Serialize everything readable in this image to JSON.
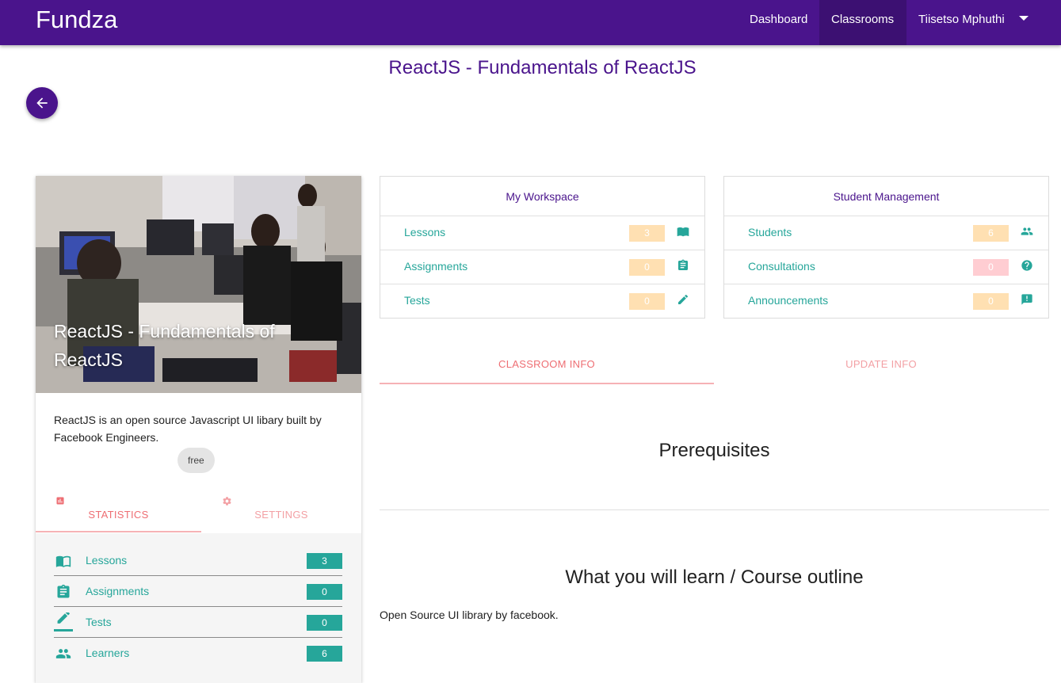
{
  "navbar": {
    "brand": "Fundza",
    "items": [
      {
        "label": "Dashboard",
        "active": false
      },
      {
        "label": "Classrooms",
        "active": true
      },
      {
        "label": "Tiisetso Mphuthi",
        "active": false
      }
    ],
    "color": "#4a148c"
  },
  "page": {
    "title": "ReactJS - Fundamentals of ReactJS",
    "back_icon": "arrow-back-icon"
  },
  "course_card": {
    "title": "ReactJS - Fundamentals of ReactJS",
    "description": "ReactJS is an open source Javascript UI libary built by Facebook Engineers.",
    "price_chip": "free",
    "tabs": [
      {
        "label": "STATISTICS",
        "icon": "bar-chart-icon",
        "active": true
      },
      {
        "label": "SETTINGS",
        "icon": "gear-icon",
        "active": false
      }
    ],
    "stats": [
      {
        "label": "Lessons",
        "count": "3",
        "icon": "book-icon"
      },
      {
        "label": "Assignments",
        "count": "0",
        "icon": "clipboard-icon"
      },
      {
        "label": "Tests",
        "count": "0",
        "icon": "pencil-icon"
      },
      {
        "label": "Learners",
        "count": "6",
        "icon": "people-icon"
      }
    ]
  },
  "workspace": {
    "title": "My Workspace",
    "rows": [
      {
        "label": "Lessons",
        "count": "3",
        "icon": "book-icon",
        "badge_color": "#ffe0b2"
      },
      {
        "label": "Assignments",
        "count": "0",
        "icon": "clipboard-icon",
        "badge_color": "#ffe0b2"
      },
      {
        "label": "Tests",
        "count": "0",
        "icon": "pencil-icon",
        "badge_color": "#ffe0b2"
      }
    ]
  },
  "student_management": {
    "title": "Student Management",
    "rows": [
      {
        "label": "Students",
        "count": "6",
        "icon": "people-icon",
        "badge_color": "#ffe0b2"
      },
      {
        "label": "Consultations",
        "count": "0",
        "icon": "help-icon",
        "badge_color": "#ffcdd2"
      },
      {
        "label": "Announcements",
        "count": "0",
        "icon": "announcement-icon",
        "badge_color": "#ffe0b2"
      }
    ]
  },
  "info_tabs": [
    {
      "label": "CLASSROOM INFO",
      "active": true
    },
    {
      "label": "UPDATE INFO",
      "active": false
    }
  ],
  "classroom_info": {
    "prerequisites_heading": "Prerequisites",
    "outline_heading": "What you will learn / Course outline",
    "outline_text": "Open Source UI library by facebook."
  },
  "colors": {
    "primary": "#4a148c",
    "teal": "#26a69a",
    "tab_active": "#ee6e73",
    "badge_orange": "#ffe0b2",
    "badge_pink": "#ffcdd2"
  }
}
